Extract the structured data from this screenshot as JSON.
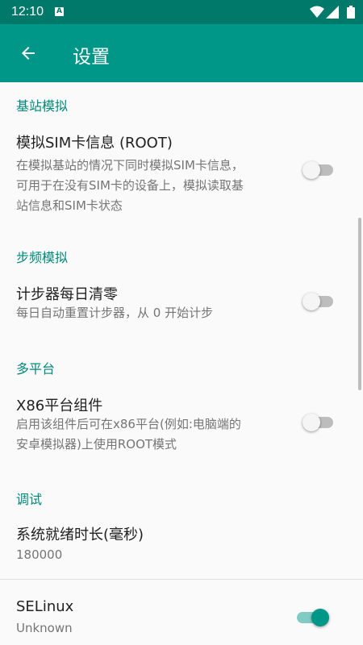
{
  "status_bar": {
    "time": "12:10",
    "notification_icon": "A"
  },
  "toolbar": {
    "title": "设置",
    "back_icon": "arrow-left-icon"
  },
  "sections": {
    "base_station": "基站模拟",
    "pedometer": "步频模拟",
    "multi_platform": "多平台",
    "debug": "调试"
  },
  "items": {
    "sim": {
      "title": "模拟SIM卡信息 (ROOT)",
      "summary_line1": "在模拟基站的情况下同时模拟SIM卡信息，",
      "summary_line2": "可用于在没有SIM卡的设备上，模拟读取基",
      "summary_line3": "站信息和SIM卡状态",
      "enabled": false
    },
    "step_reset": {
      "title": "计步器每日清零",
      "summary": "每日自动重置计步器，从 0 开始计步",
      "enabled": false
    },
    "x86": {
      "title": "X86平台组件",
      "summary_line1": "启用该组件后可在x86平台(例如:电脑端的",
      "summary_line2": "安卓模拟器)上使用ROOT模式",
      "enabled": false
    },
    "ready_time": {
      "title": "系统就绪时长(毫秒)",
      "value": "180000"
    },
    "selinux": {
      "title": "SELinux",
      "value": "Unknown",
      "enabled": true
    }
  },
  "colors": {
    "status_bar": "#00796b",
    "toolbar": "#009688",
    "accent": "#00897b"
  }
}
